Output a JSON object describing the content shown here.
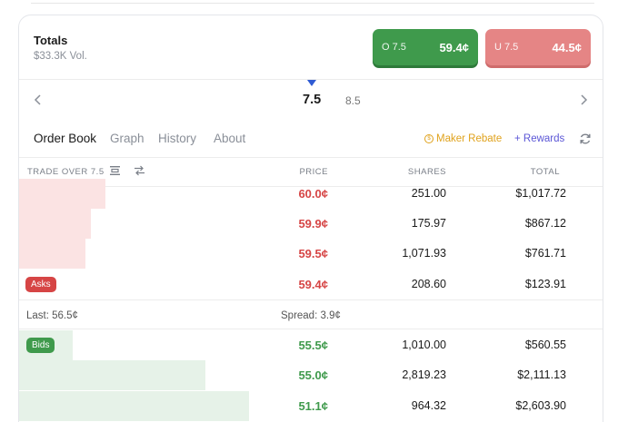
{
  "header": {
    "title": "Totals",
    "volume": "$33.3K Vol."
  },
  "markets": {
    "over": {
      "label": "O 7.5",
      "price": "59.4¢",
      "color": "#3f9a4c"
    },
    "under": {
      "label": "U 7.5",
      "price": "44.5¢",
      "color": "#e58585"
    }
  },
  "lines": {
    "active": "7.5",
    "other": "8.5",
    "prev_icon": "chevron-left-icon",
    "next_icon": "chevron-right-icon"
  },
  "tabs": [
    "Order Book",
    "Graph",
    "History",
    "About"
  ],
  "active_tab": "Order Book",
  "actions": {
    "maker_rebate": "Maker Rebate",
    "rewards": "+ Rewards",
    "refresh_icon": "refresh-icon"
  },
  "columns": {
    "trade": "TRADE OVER 7.5",
    "price": "PRICE",
    "shares": "SHARES",
    "total": "TOTAL"
  },
  "asks": [
    {
      "price": "60.0¢",
      "shares": "251.00",
      "total": "$1,017.72",
      "depth": 0.147
    },
    {
      "price": "59.9¢",
      "shares": "175.97",
      "total": "$867.12",
      "depth": 0.123
    },
    {
      "price": "59.5¢",
      "shares": "1,071.93",
      "total": "$761.71",
      "depth": 0.113
    },
    {
      "price": "59.4¢",
      "shares": "208.60",
      "total": "$123.91",
      "depth": 0.0
    }
  ],
  "labels": {
    "asks": "Asks",
    "bids": "Bids"
  },
  "mid": {
    "last": "Last: 56.5¢",
    "spread": "Spread: 3.9¢"
  },
  "bids": [
    {
      "price": "55.5¢",
      "shares": "1,010.00",
      "total": "$560.55",
      "depth": 0.092
    },
    {
      "price": "55.0¢",
      "shares": "2,819.23",
      "total": "$2,111.13",
      "depth": 0.319
    },
    {
      "price": "51.1¢",
      "shares": "964.32",
      "total": "$2,603.90",
      "depth": 0.393
    }
  ],
  "colors": {
    "ask": "#d64545",
    "bid": "#3f9a4c",
    "maker": "#e0a21c",
    "rewards": "#5b56d6"
  }
}
